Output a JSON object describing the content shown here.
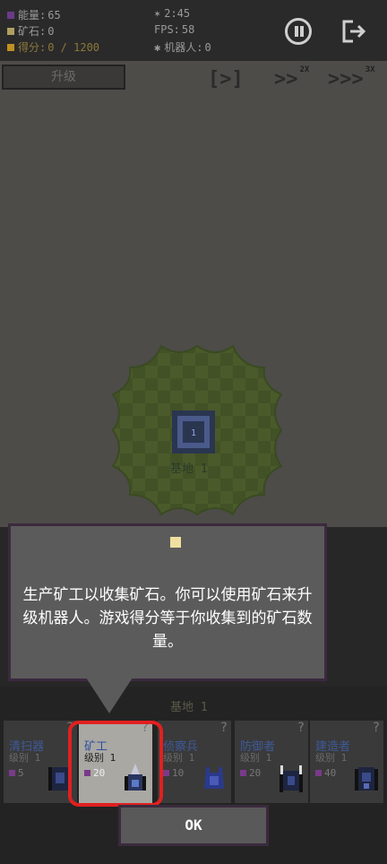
{
  "hud": {
    "energy_label": "能量:",
    "energy_value": "65",
    "ore_label": "矿石:",
    "ore_value": "0",
    "score_label": "得分:",
    "score_value": "0 / 1200",
    "timer": "2:45",
    "fps_label": "FPS:",
    "fps_value": "58",
    "robots_label": "机器人:",
    "robots_value": "0",
    "colors": {
      "energy": "#6a3a8a",
      "ore": "#b0a060",
      "score": "#c09020"
    }
  },
  "toolbar": {
    "upgrade_label": "升级",
    "speed_1x": "[>]",
    "speed_2x": ">>",
    "speed_2x_tag": "2X",
    "speed_3x": ">>>",
    "speed_3x_tag": "3X"
  },
  "base": {
    "label": "基地",
    "level": "1",
    "core_number": "1"
  },
  "tooltip": {
    "text": "生产矿工以收集矿石。你可以使用矿石来升级机器人。游戏得分等于你收集到的矿石数量。",
    "icon": "ore-icon"
  },
  "panel": {
    "title": "基地 1",
    "cards": [
      {
        "name": "清扫器",
        "level": "级别 1",
        "cost": "5",
        "help": "?"
      },
      {
        "name": "矿工",
        "level": "级别 1",
        "cost": "20",
        "help": "?"
      },
      {
        "name": "侦察兵",
        "level": "级别 1",
        "cost": "10",
        "help": "?"
      },
      {
        "name": "防御者",
        "level": "级别 1",
        "cost": "20",
        "help": "?"
      },
      {
        "name": "建造者",
        "level": "级别 1",
        "cost": "40",
        "help": "?"
      }
    ]
  },
  "ok_label": "OK"
}
